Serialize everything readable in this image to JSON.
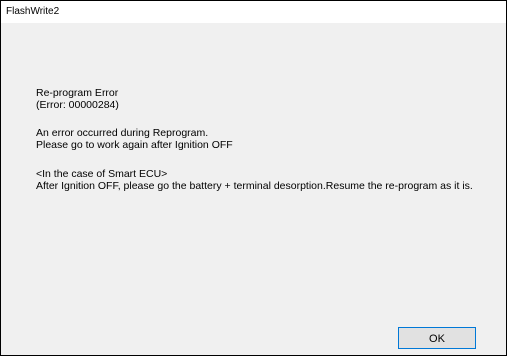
{
  "window": {
    "title": "FlashWrite2"
  },
  "message": {
    "heading": "Re-program Error",
    "error_code": "(Error: 00000284)",
    "line1": "An error occurred during Reprogram.",
    "line2": "Please go to work again after Ignition OFF",
    "smart_ecu_heading": "<In the case of Smart ECU>",
    "smart_ecu_text": "After Ignition OFF, please go the battery + terminal desorption.Resume the re-program as it is."
  },
  "buttons": {
    "ok_label": "OK"
  },
  "colors": {
    "dialog_background": "#f0f0f0",
    "titlebar_background": "#ffffff",
    "button_background": "#e1e1e1"
  }
}
